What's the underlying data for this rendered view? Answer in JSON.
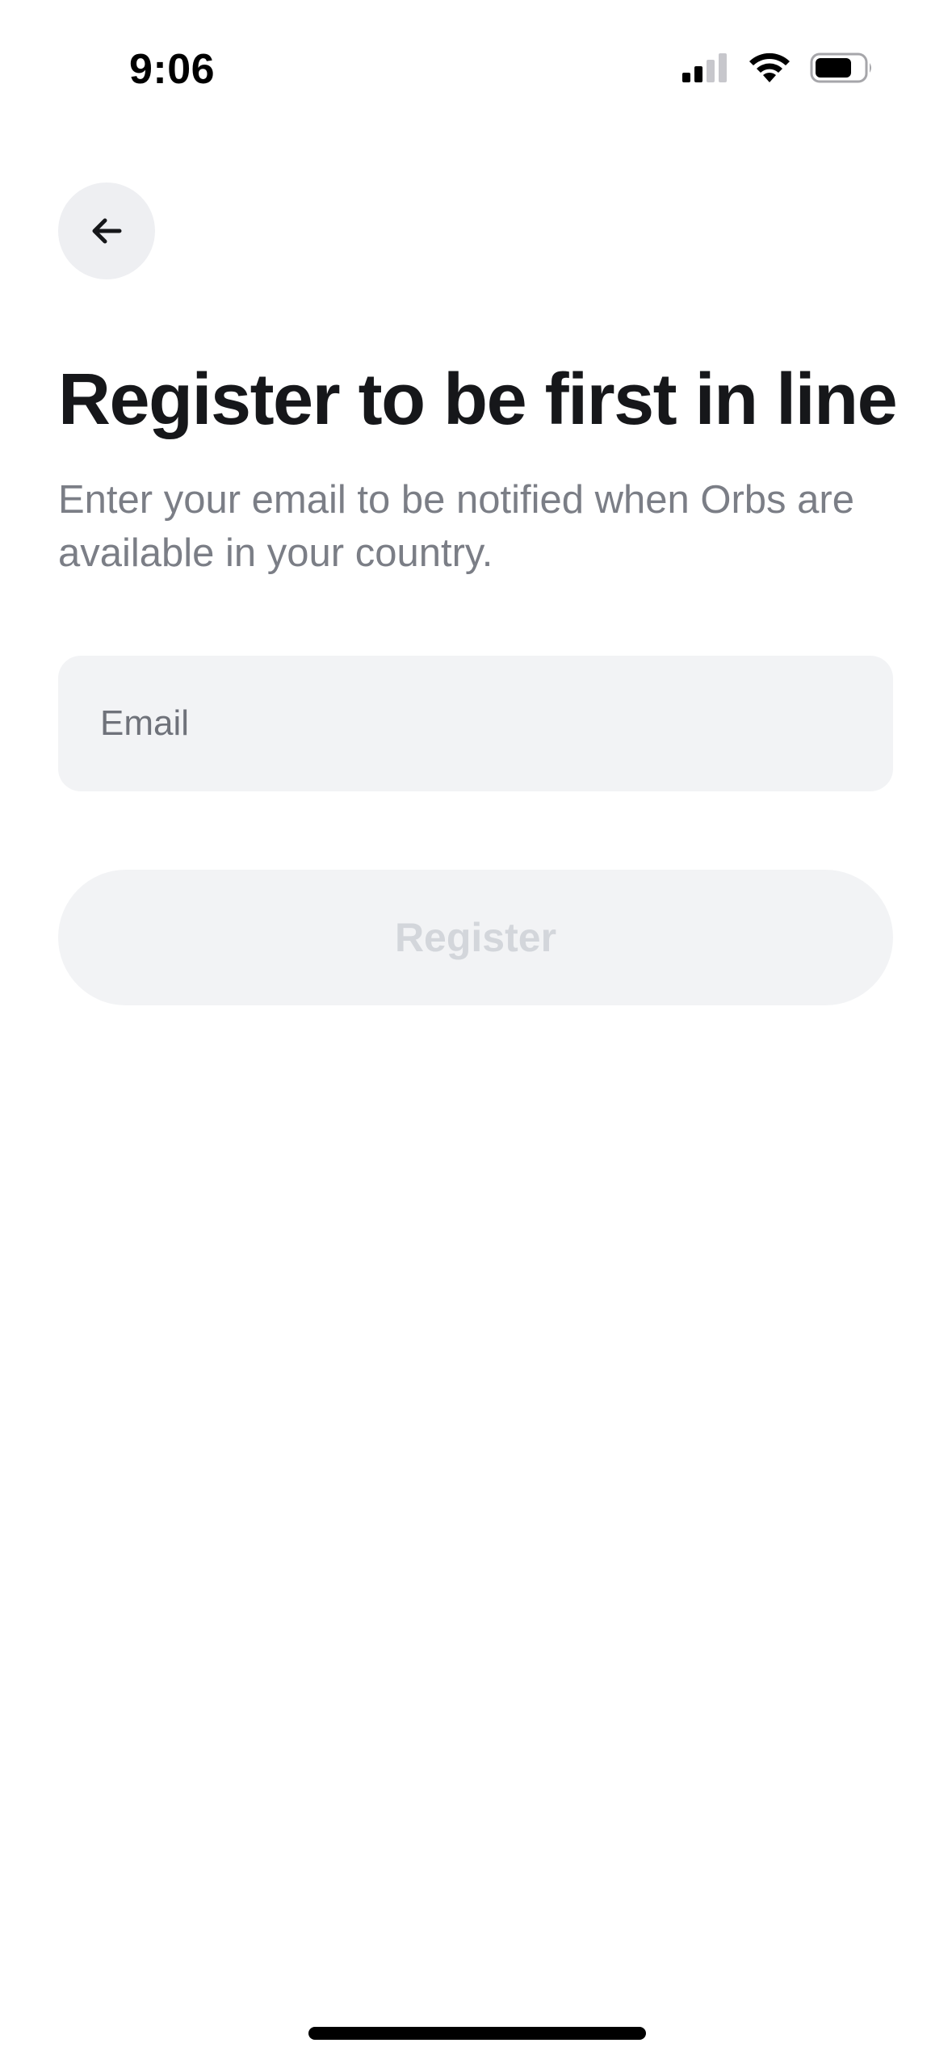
{
  "status_bar": {
    "time": "9:06",
    "icons": [
      "signal-icon",
      "wifi-icon",
      "battery-icon"
    ]
  },
  "header": {
    "back_icon": "arrow-left-icon",
    "title": "Register to be first in line",
    "subtitle": "Enter your email to be notified when Orbs are available in your country."
  },
  "form": {
    "email": {
      "value": "",
      "placeholder": "Email"
    },
    "register_label": "Register",
    "register_enabled": false
  },
  "colors": {
    "title_text": "#16171a",
    "subtitle_text": "#7b7e86",
    "field_background": "#f2f3f5",
    "back_button_background": "#eeeff2",
    "disabled_button_text": "#d3d6db"
  }
}
